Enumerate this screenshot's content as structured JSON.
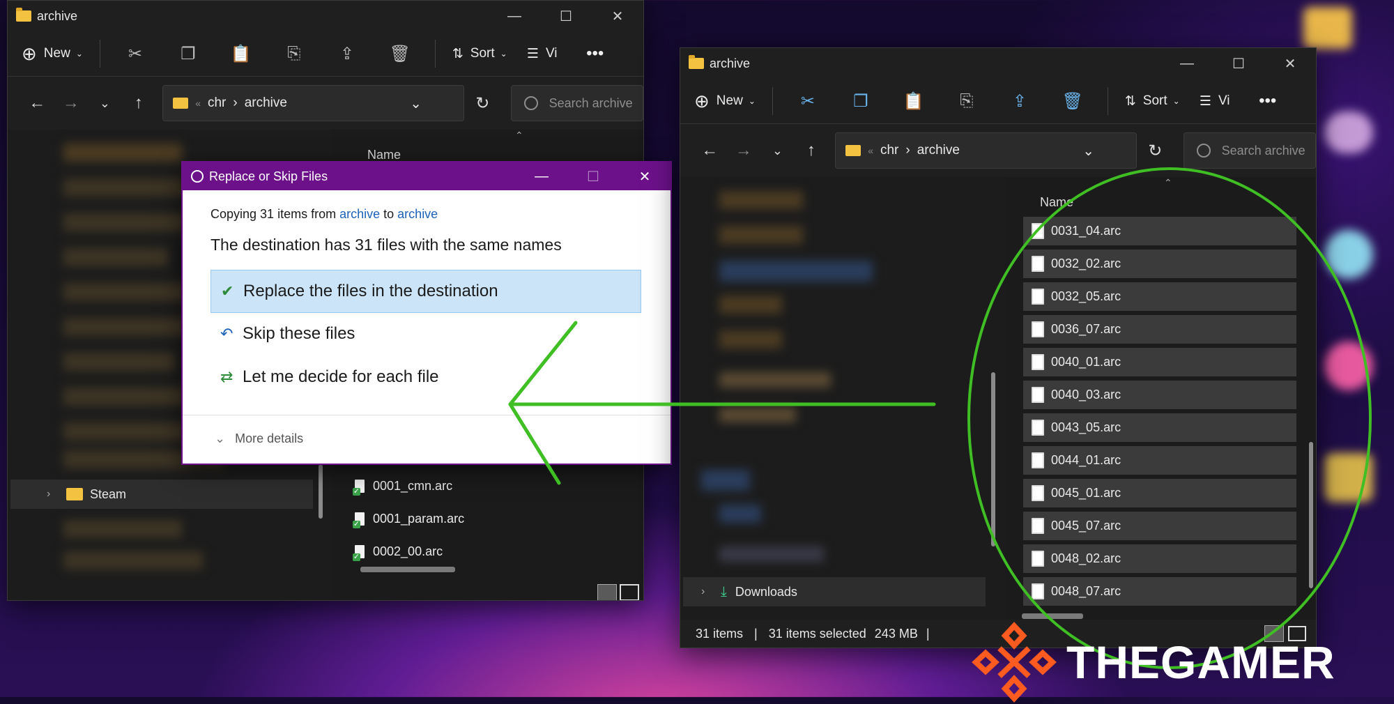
{
  "colors": {
    "accent_purple": "#6c118a",
    "selection_blue": "#cce4f7",
    "circle_green": "#3fbf24",
    "link_blue": "#1c62b9"
  },
  "left_window": {
    "title": "archive",
    "toolbar": {
      "new_label": "New",
      "sort_label": "Sort",
      "view_label": "Vi",
      "icons": [
        "cut-icon",
        "copy-icon",
        "paste-icon",
        "rename-icon",
        "share-icon",
        "delete-icon"
      ]
    },
    "address": {
      "parts": [
        "chr",
        "archive"
      ]
    },
    "search_placeholder": "Search archive",
    "column_name": "Name",
    "nav_items": [
      {
        "label": "Steam"
      }
    ],
    "files": [
      "0001_cmn.arc",
      "0001_param.arc",
      "0002_00.arc"
    ]
  },
  "right_window": {
    "title": "archive",
    "toolbar": {
      "new_label": "New",
      "sort_label": "Sort",
      "view_label": "Vi"
    },
    "address": {
      "parts": [
        "chr",
        "archive"
      ]
    },
    "search_placeholder": "Search archive",
    "column_name": "Name",
    "nav_items": [
      {
        "label": "Downloads"
      }
    ],
    "files": [
      "0031_04.arc",
      "0032_02.arc",
      "0032_05.arc",
      "0036_07.arc",
      "0040_01.arc",
      "0040_03.arc",
      "0043_05.arc",
      "0044_01.arc",
      "0045_01.arc",
      "0045_07.arc",
      "0048_02.arc",
      "0048_07.arc"
    ],
    "status": {
      "items": "31 items",
      "selected": "31 items selected",
      "size": "243 MB"
    }
  },
  "dialog": {
    "title": "Replace or Skip Files",
    "copy_prefix": "Copying 31 items from",
    "source": "archive",
    "to_word": "to",
    "dest": "archive",
    "heading": "The destination has 31 files with the same names",
    "options": [
      "Replace the files in the destination",
      "Skip these files",
      "Let me decide for each file"
    ],
    "more_details": "More details"
  },
  "watermark": {
    "brand": "THEGAMER"
  }
}
